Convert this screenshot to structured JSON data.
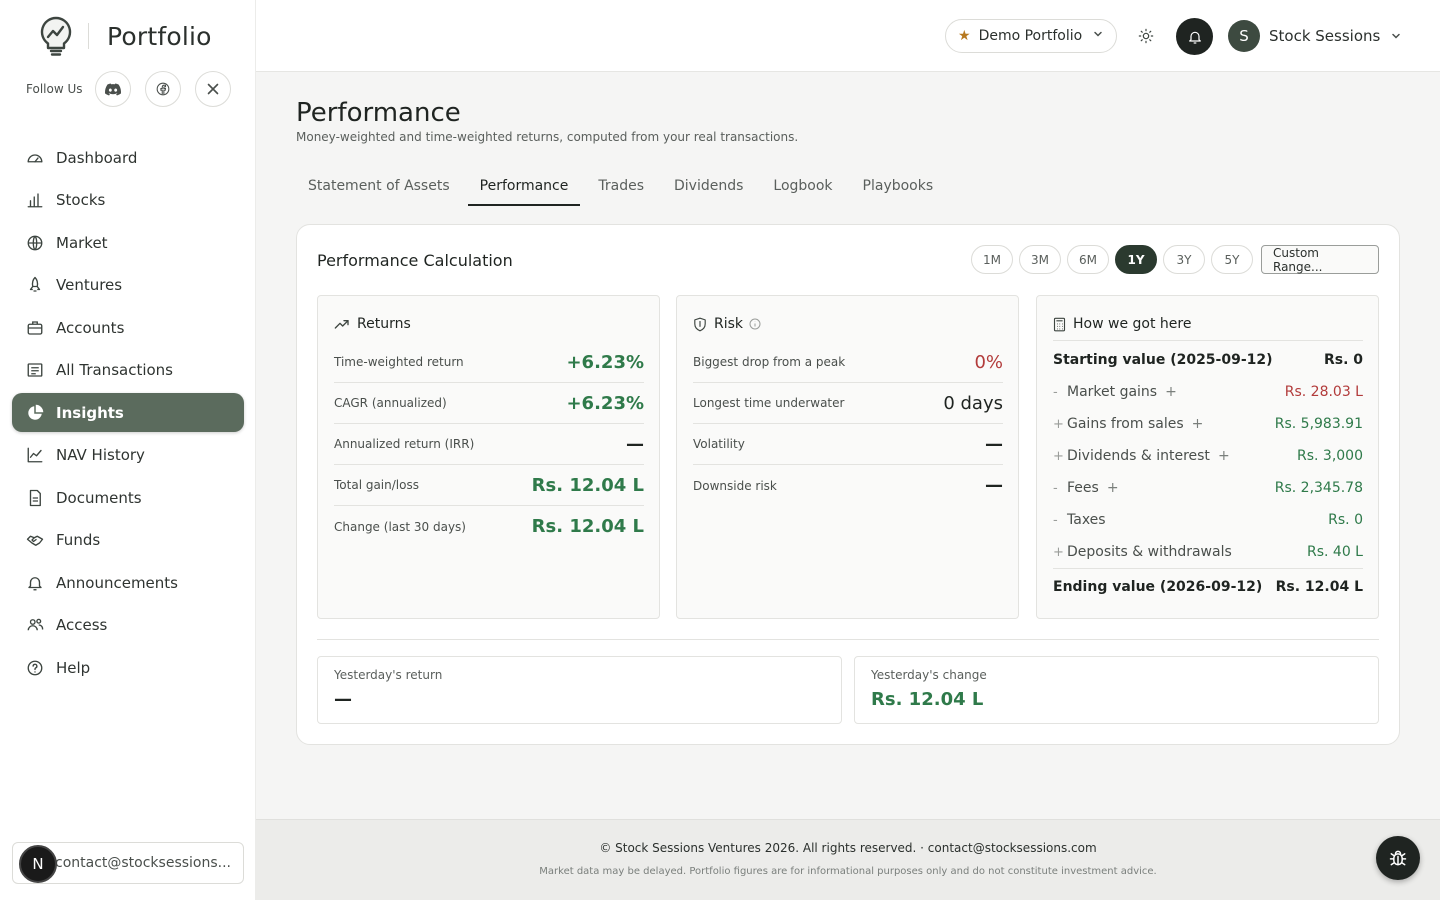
{
  "brand": {
    "name": "Portfolio",
    "logo_icon": "lightbulb-chart-icon"
  },
  "follow": {
    "label": "Follow Us",
    "icons": [
      "discord-icon",
      "facebook-icon",
      "x-icon"
    ]
  },
  "nav": {
    "items": [
      {
        "label": "Dashboard",
        "icon": "gauge-icon"
      },
      {
        "label": "Stocks",
        "icon": "bar-chart-icon"
      },
      {
        "label": "Market",
        "icon": "globe-icon"
      },
      {
        "label": "Ventures",
        "icon": "rocket-icon"
      },
      {
        "label": "Accounts",
        "icon": "briefcase-icon"
      },
      {
        "label": "All Transactions",
        "icon": "receipt-icon"
      },
      {
        "label": "Insights",
        "icon": "pie-chart-icon",
        "active": true
      },
      {
        "label": "NAV History",
        "icon": "line-chart-icon"
      },
      {
        "label": "Documents",
        "icon": "document-icon"
      },
      {
        "label": "Funds",
        "icon": "handshake-icon"
      },
      {
        "label": "Announcements",
        "icon": "bell-icon"
      },
      {
        "label": "Access",
        "icon": "users-icon"
      },
      {
        "label": "Help",
        "icon": "help-icon"
      }
    ]
  },
  "user_chip": {
    "avatar_letter": "N",
    "email": "contact@stocksessions...."
  },
  "topbar": {
    "portfolio": "Demo Portfolio",
    "account_initial": "S",
    "account_name": "Stock Sessions"
  },
  "page": {
    "title": "Performance",
    "subtitle": "Money-weighted and time-weighted returns, computed from your real transactions.",
    "tabs": [
      "Statement of Assets",
      "Performance",
      "Trades",
      "Dividends",
      "Logbook",
      "Playbooks"
    ],
    "active_tab": "Performance"
  },
  "card": {
    "title": "Performance Calculation",
    "ranges": [
      "1M",
      "3M",
      "6M",
      "1Y",
      "3Y",
      "5Y"
    ],
    "active_range": "1Y",
    "custom_range": "Custom Range...",
    "returns": {
      "title": "Returns",
      "rows": [
        {
          "label": "Time-weighted return",
          "value": "+6.23%"
        },
        {
          "label": "CAGR (annualized)",
          "value": "+6.23%"
        },
        {
          "label": "Annualized return (IRR)",
          "value": "—"
        },
        {
          "label": "Total gain/loss",
          "value": "Rs. 12.04 L"
        },
        {
          "label": "Change (last 30 days)",
          "value": "Rs. 12.04 L"
        }
      ]
    },
    "risk": {
      "title": "Risk",
      "rows": [
        {
          "label": "Biggest drop from a peak",
          "value": "0%"
        },
        {
          "label": "Longest time underwater",
          "value": "0 days"
        },
        {
          "label": "Volatility",
          "value": "—"
        },
        {
          "label": "Downside risk",
          "value": "—"
        }
      ]
    },
    "how": {
      "title": "How we got here",
      "start": {
        "label": "Starting value (2025-09-12)",
        "value": "Rs. 0"
      },
      "rows": [
        {
          "sign": "-",
          "label": "Market gains",
          "value": "Rs. 28.03 L"
        },
        {
          "sign": "+",
          "label": "Gains from sales",
          "value": "Rs. 5,983.91"
        },
        {
          "sign": "+",
          "label": "Dividends & interest",
          "value": "Rs. 3,000"
        },
        {
          "sign": "-",
          "label": "Fees",
          "value": "Rs. 2,345.78"
        },
        {
          "sign": "-",
          "label": "Taxes",
          "value": "Rs. 0"
        },
        {
          "sign": "+",
          "label": "Deposits & withdrawals",
          "value": "Rs. 40 L"
        }
      ],
      "end": {
        "label": "Ending value (2026-09-12)",
        "value": "Rs. 12.04 L"
      }
    },
    "yesterday_return": {
      "label": "Yesterday's return",
      "value": "—"
    },
    "yesterday_change": {
      "label": "Yesterday's change",
      "value": "Rs. 12.04 L"
    }
  },
  "footer": {
    "copyright": "© Stock Sessions Ventures 2026. All rights reserved. · contact@stocksessions.com",
    "disclaimer": "Market data may be delayed. Portfolio figures are for informational purposes only and do not constitute investment advice."
  },
  "colors": {
    "accent": "#5b6b5d",
    "positive": "#2f7a4a",
    "negative": "#b23b3b",
    "dark": "#1f2421"
  }
}
